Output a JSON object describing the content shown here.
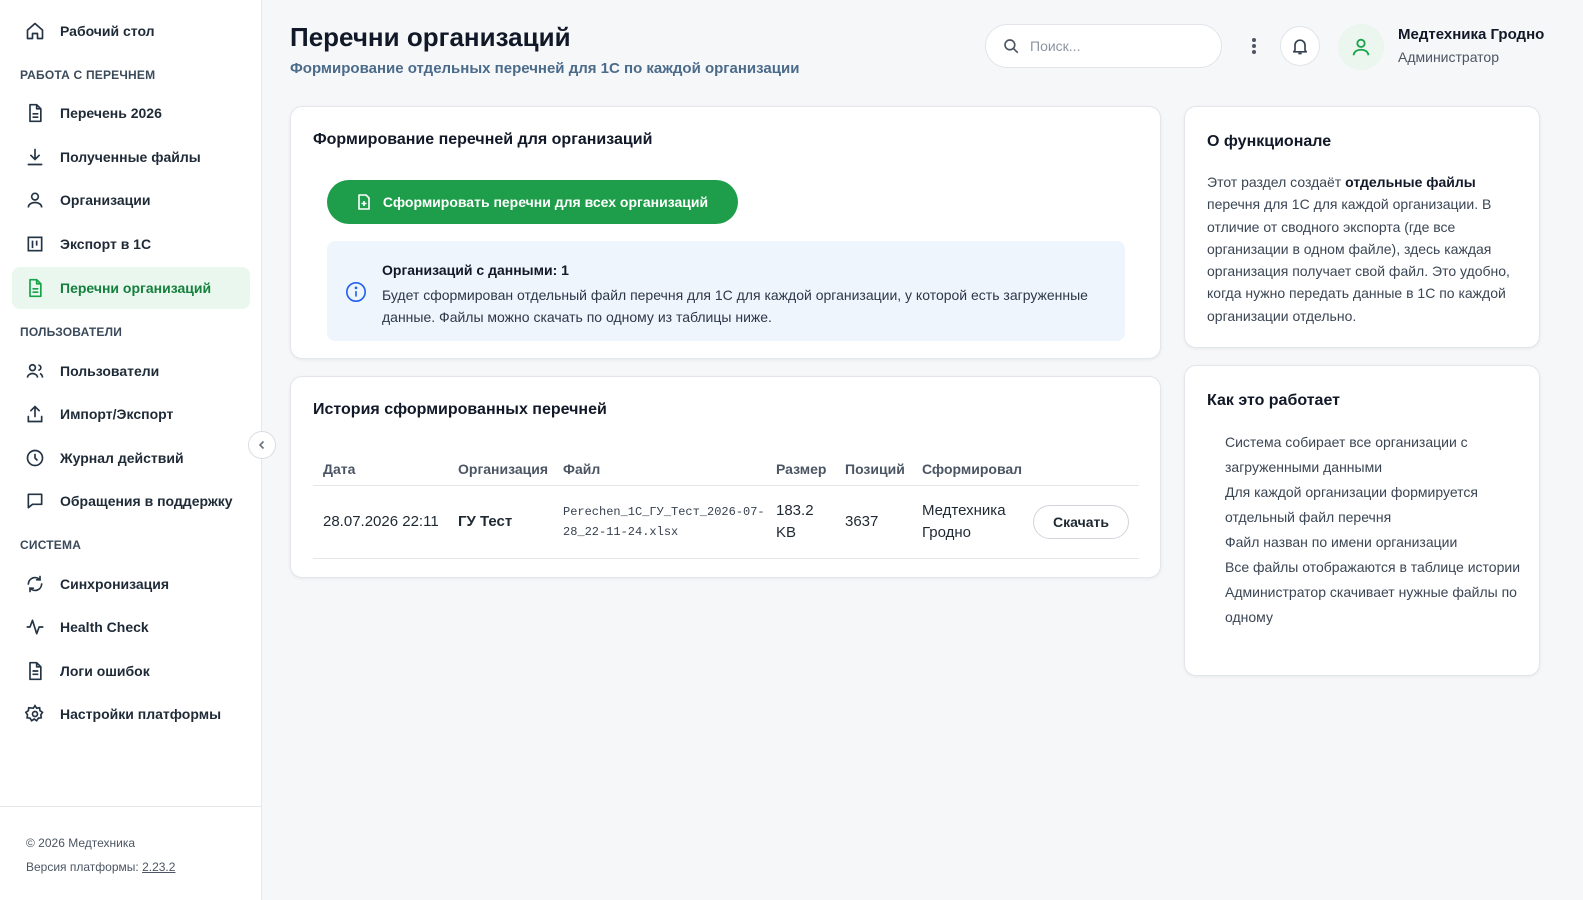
{
  "sidebar": {
    "items": [
      {
        "label": "Рабочий стол",
        "icon": "home-icon"
      },
      {
        "label": "Перечень 2026",
        "icon": "document-icon"
      },
      {
        "label": "Полученные файлы",
        "icon": "download-icon"
      },
      {
        "label": "Организации",
        "icon": "user-icon"
      },
      {
        "label": "Экспорт в 1С",
        "icon": "export-icon"
      },
      {
        "label": "Перечни организаций",
        "icon": "document-icon"
      },
      {
        "label": "Пользователи",
        "icon": "users-icon"
      },
      {
        "label": "Импорт/Экспорт",
        "icon": "upload-icon"
      },
      {
        "label": "Журнал действий",
        "icon": "clock-icon"
      },
      {
        "label": "Обращения в поддержку",
        "icon": "chat-icon"
      },
      {
        "label": "Синхронизация",
        "icon": "sync-icon"
      },
      {
        "label": "Health Check",
        "icon": "activity-icon"
      },
      {
        "label": "Логи ошибок",
        "icon": "log-icon"
      },
      {
        "label": "Настройки платформы",
        "icon": "gear-icon"
      }
    ],
    "sections": {
      "work": "РАБОТА С ПЕРЕЧНЕМ",
      "users": "ПОЛЬЗОВАТЕЛИ",
      "system": "СИСТЕМА"
    },
    "active_index": 5,
    "footer": {
      "copyright": "© 2026 Медтехника",
      "version_label": "Версия платформы: ",
      "version": "2.23.2"
    }
  },
  "header": {
    "title": "Перечни организаций",
    "subtitle": "Формирование отдельных перечней для 1С по каждой организации",
    "search_placeholder": "Поиск...",
    "user_name": "Медтехника Гродно",
    "user_role": "Администратор"
  },
  "generate_card": {
    "title": "Формирование перечней для организаций",
    "button_label": "Сформировать перечни для всех организаций",
    "info_title": "Организаций с данными: 1",
    "info_text": "Будет сформирован отдельный файл перечня для 1С для каждой организации, у которой есть загруженные данные. Файлы можно скачать по одному из таблицы ниже."
  },
  "history_card": {
    "title": "История сформированных перечней",
    "columns": [
      "Дата",
      "Организация",
      "Файл",
      "Размер",
      "Позиций",
      "Сформировал"
    ],
    "rows": [
      {
        "date": "28.07.2026 22:11",
        "organization": "ГУ Тест",
        "file": "Perechen_1C_ГУ_Тест_2026-07-28_22-11-24.xlsx",
        "size": "183.2 KB",
        "positions": "3637",
        "created_by": "Медтехника Гродно",
        "action": "Скачать"
      }
    ]
  },
  "about_card": {
    "title": "О функционале",
    "text_before": "Этот раздел создаёт ",
    "text_bold": "отдельные файлы",
    "text_after": " перечня для 1С для каждой организации. В отличие от сводного экспорта (где все организации в одном файле), здесь каждая организация получает свой файл. Это удобно, когда нужно передать данные в 1С по каждой организации отдельно."
  },
  "how_card": {
    "title": "Как это работает",
    "steps": [
      "Система собирает все организации с загруженными данными",
      "Для каждой организации формируется отдельный файл перечня",
      "Файл назван по имени организации",
      "Все файлы отображаются в таблице истории",
      "Администратор скачивает нужные файлы по одному"
    ]
  },
  "colors": {
    "accent": "#1e9e4a",
    "active_bg": "#e9f7ee",
    "info_bg": "#eef5fd",
    "info_icon": "#2563eb"
  }
}
